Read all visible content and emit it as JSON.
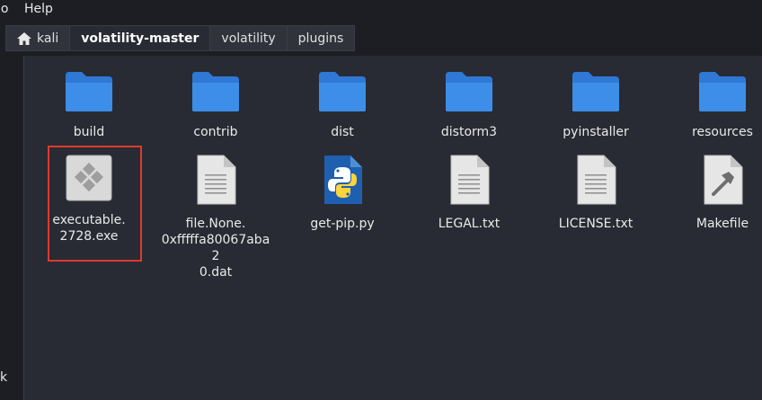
{
  "menubar": {
    "go": "Go",
    "help": "Help"
  },
  "pathbar": {
    "crumbs": [
      {
        "label": "kali",
        "icon": "home-icon"
      },
      {
        "label": "volatility-master"
      },
      {
        "label": "volatility"
      },
      {
        "label": "plugins"
      }
    ]
  },
  "sidebar": {
    "partial_text": "k"
  },
  "files": {
    "build": {
      "label": "build",
      "icon": "folder-icon"
    },
    "contrib": {
      "label": "contrib",
      "icon": "folder-icon"
    },
    "dist": {
      "label": "dist",
      "icon": "folder-icon"
    },
    "distorm3": {
      "label": "distorm3",
      "icon": "folder-icon"
    },
    "pyinstaller": {
      "label": "pyinstaller",
      "icon": "folder-icon"
    },
    "resources": {
      "label": "resources",
      "icon": "folder-icon"
    },
    "exe": {
      "label": "executable.\n2728.exe",
      "icon": "executable-icon"
    },
    "dat": {
      "label": "file.None.\n0xfffffa80067aba2\n0.dat",
      "icon": "text-file-icon"
    },
    "getpip": {
      "label": "get-pip.py",
      "icon": "python-file-icon"
    },
    "legal": {
      "label": "LEGAL.txt",
      "icon": "text-file-icon"
    },
    "license": {
      "label": "LICENSE.txt",
      "icon": "text-file-icon"
    },
    "makefile": {
      "label": "Makefile",
      "icon": "makefile-icon"
    }
  },
  "colors": {
    "folder": "#3d8ee8",
    "highlight": "#e0392f"
  }
}
